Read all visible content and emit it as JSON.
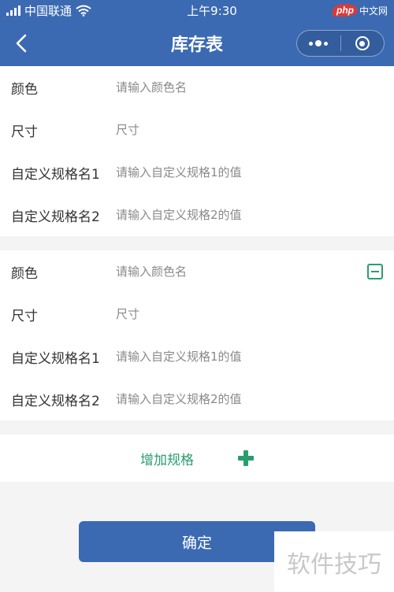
{
  "status_bar": {
    "carrier": "中国联通",
    "time": "上午9:30",
    "logo_text": "php",
    "logo_site": "中文网"
  },
  "nav": {
    "title": "库存表",
    "back_icon": "chevron-left-icon",
    "more_icon": "more-dots-icon",
    "close_icon": "target-close-icon"
  },
  "spec_groups": [
    {
      "rows": [
        {
          "label": "颜色",
          "placeholder": "请输入颜色名"
        },
        {
          "label": "尺寸",
          "placeholder": "尺寸"
        },
        {
          "label": "自定义规格名1",
          "placeholder": "请输入自定义规格1的值"
        },
        {
          "label": "自定义规格名2",
          "placeholder": "请输入自定义规格2的值"
        }
      ]
    },
    {
      "rows": [
        {
          "label": "颜色",
          "placeholder": "请输入颜色名"
        },
        {
          "label": "尺寸",
          "placeholder": "尺寸"
        },
        {
          "label": "自定义规格名1",
          "placeholder": "请输入自定义规格1的值"
        },
        {
          "label": "自定义规格名2",
          "placeholder": "请输入自定义规格2的值"
        }
      ]
    }
  ],
  "add_spec": {
    "label": "增加规格"
  },
  "confirm": {
    "label": "确定"
  },
  "watermark": {
    "text": "软件技巧"
  },
  "colors": {
    "primary": "#3b6ab3",
    "accent": "#2a9d6f",
    "background": "#f4f4f4"
  }
}
